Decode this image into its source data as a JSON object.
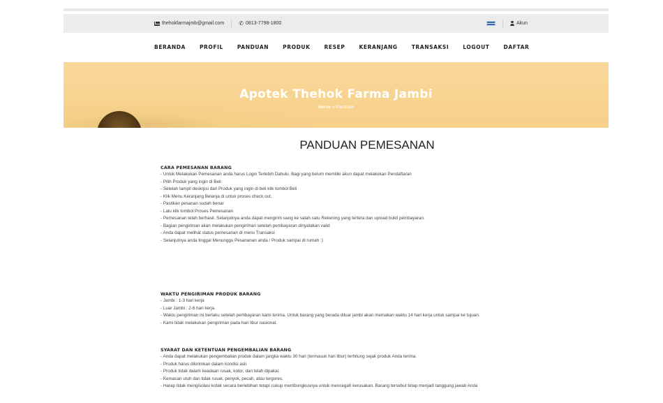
{
  "topbar": {
    "email": "thehokfarmajmb@gmail.com",
    "phone": "0813-7798-1800",
    "account_label": "Akun"
  },
  "nav": {
    "items": [
      "BERANDA",
      "PROFIL",
      "PANDUAN",
      "PRODUK",
      "RESEP",
      "KERANJANG",
      "TRANSAKSI",
      "LOGOUT",
      "DAFTAR"
    ]
  },
  "hero": {
    "title": "Apotek Thehok Farma Jambi",
    "breadcrumb_home": "Home",
    "breadcrumb_sep": "»",
    "breadcrumb_current": "Panduan"
  },
  "page": {
    "title": "PANDUAN PEMESANAN"
  },
  "sections": [
    {
      "heading": "CARA PEMESANAN BARANG",
      "lines": [
        "- Untuk Melakukan Pemesanan anda harus Login Terlebih Dahulu. Bagi yang belum memiliki akun dapat melakukan Pendaftaran",
        "- Pilih Produk yang ingin di Beli",
        "- Setelah tampil deskrpsi dari Produk yang ingin di beli klik tombol Beli",
        "- Klik Menu Keranjang Belanja di untuk proses check out.",
        "- Pastikan pesanan sudah benar",
        "- Lalu klik tombol Proses Pemesanan",
        "- Pemesanan telah berhasil. Selanjutnya anda dapat mengirim uang ke salah satu Rekening yang tertera dan upload bukti pembayaran.",
        "- Bagian pengiriman akan melakukan pengiriman setelah pembayaran dinyatakan valid",
        "- Anda dapat melihat status pemesanan di menu Transaksi",
        "- Selanjutnya anda tinggal Menunggu Pesananan anda / Produk sampai di rumah :)"
      ]
    },
    {
      "heading": "WAKTU PENGIRIMAN PRODUK BARANG",
      "lines": [
        "- Jambi : 1-3 hari kerja",
        "- Luar Jambi : 2-6 hari kerja.",
        "- Waktu pengiriman ini berlaku setelah pembayaran kami terima. Untuk barang yang berada diluar jambi akan memakan waktu 14 hari kerja untuk sampai ke tujuan.",
        "- Kami tidak melakukan pengiriman pada hari libur nasional."
      ]
    },
    {
      "heading": "SYARAT DAN KETENTUAN PENGEMBALIAN BARANG",
      "lines": [
        "- Anda dapat melakukan pengembalian produk dalam jangka waktu 30 hari (termasuk hari libur) terhitung sejak produk Anda terima.",
        "- Produk harus dikirimkan dalam kondisi asli.",
        "- Produk tidak dalam keadaan rusak, kotor, dan telah dipakai.",
        "- Kemasan utuh dan tidak rusak, penyok, pecah, atau tergores.",
        "- Harap tidak mengisolasi kotak secara berlebihan tetapi cukup membungkusnya untuk mencegah kerusakan. Barang tersebut tetap menjadi tanggung jawab Anda"
      ]
    }
  ]
}
